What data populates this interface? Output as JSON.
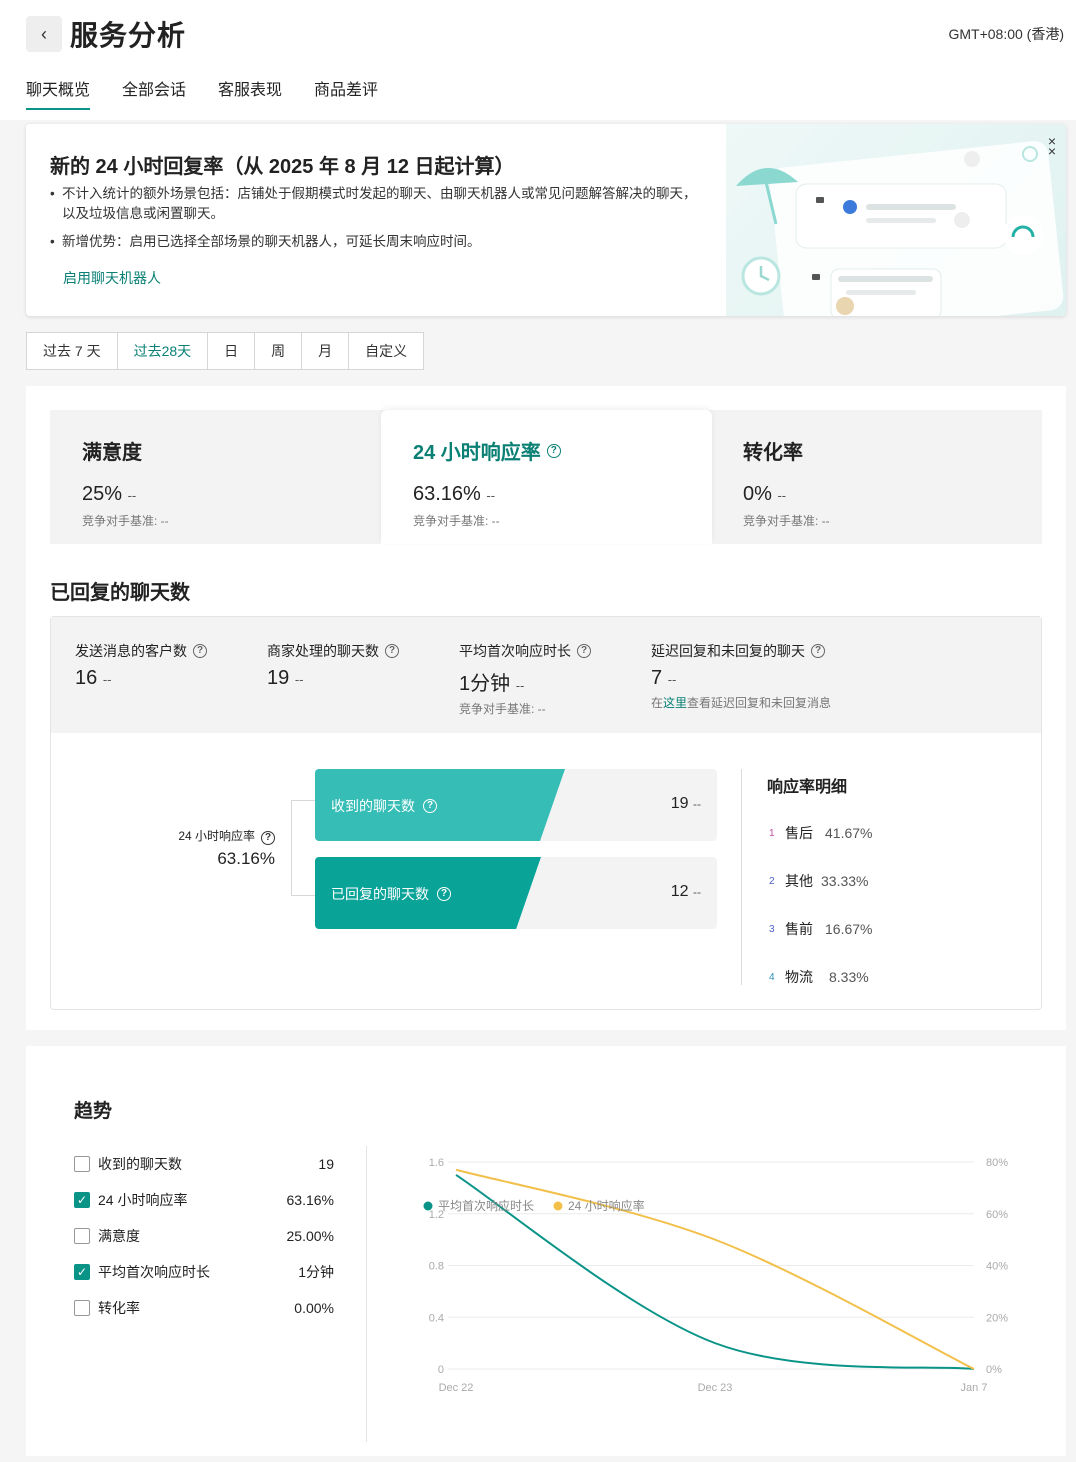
{
  "header": {
    "back_icon": "chevron-left-icon",
    "title": "服务分析",
    "timezone": "GMT+08:00 (香港)"
  },
  "tabs": [
    {
      "label": "聊天概览",
      "active": true
    },
    {
      "label": "全部会话",
      "active": false
    },
    {
      "label": "客服表现",
      "active": false
    },
    {
      "label": "商品差评",
      "active": false
    }
  ],
  "banner": {
    "title": "新的 24 小时回复率（从 2025 年 8 月 12 日起计算）",
    "bullets": [
      "不计入统计的额外场景包括：店铺处于假期模式时发起的聊天、由聊天机器人或常见问题解答解决的聊天，以及垃圾信息或闲置聊天。",
      "新增优势：启用已选择全部场景的聊天机器人，可延长周末响应时间。"
    ],
    "link": "启用聊天机器人",
    "close_icon": "close-icon"
  },
  "date_range": {
    "options": [
      "过去 7 天",
      "过去28天",
      "日",
      "周",
      "月",
      "自定义"
    ],
    "selected": "过去28天"
  },
  "kpis": [
    {
      "title": "满意度",
      "value": "25%",
      "delta": "--",
      "bench": "竞争对手基准: --",
      "active": false
    },
    {
      "title": "24 小时响应率",
      "value": "63.16%",
      "delta": "--",
      "bench": "竞争对手基准: --",
      "active": true
    },
    {
      "title": "转化率",
      "value": "0%",
      "delta": "--",
      "bench": "竞争对手基准: --",
      "active": false
    }
  ],
  "replied": {
    "section_title": "已回复的聊天数",
    "stats": [
      {
        "label": "发送消息的客户数",
        "value": "16",
        "delta": "--"
      },
      {
        "label": "商家处理的聊天数",
        "value": "19",
        "delta": "--"
      },
      {
        "label": "平均首次响应时长",
        "value": "1分钟",
        "delta": "--",
        "sub": "竞争对手基准: --"
      },
      {
        "label": "延迟回复和未回复的聊天",
        "value": "7",
        "delta": "--",
        "sub_prefix": "在",
        "sub_link": "这里",
        "sub_suffix": "查看延迟回复和未回复消息"
      }
    ],
    "rate_label": "24 小时响应率",
    "rate_value": "63.16%",
    "funnel": [
      {
        "label": "收到的聊天数",
        "value": "19",
        "delta": "--",
        "color": "#35bdb6"
      },
      {
        "label": "已回复的聊天数",
        "value": "12",
        "delta": "--",
        "color": "#0aa398"
      }
    ],
    "detail": {
      "title": "响应率明细",
      "items": [
        {
          "index": "1",
          "name": "售后",
          "pct": "41.67%",
          "index_color": "#c04ca0"
        },
        {
          "index": "2",
          "name": "其他",
          "pct": "33.33%",
          "index_color": "#4a5ec8"
        },
        {
          "index": "3",
          "name": "售前",
          "pct": "16.67%",
          "index_color": "#4a5ec8"
        },
        {
          "index": "4",
          "name": "物流",
          "pct": "8.33%",
          "index_color": "#2e8fb8"
        }
      ]
    }
  },
  "trend": {
    "title": "趋势",
    "metrics": [
      {
        "label": "收到的聊天数",
        "value": "19",
        "checked": false
      },
      {
        "label": "24 小时响应率",
        "value": "63.16%",
        "checked": true
      },
      {
        "label": "满意度",
        "value": "25.00%",
        "checked": false
      },
      {
        "label": "平均首次响应时长",
        "value": "1分钟",
        "checked": true
      },
      {
        "label": "转化率",
        "value": "0.00%",
        "checked": false
      }
    ]
  },
  "chart_data": {
    "type": "line",
    "x": [
      "Dec 22",
      "Dec 23",
      "Jan 7"
    ],
    "series": [
      {
        "name": "平均首次响应时长",
        "axis": "left",
        "color": "#0a9488",
        "values": [
          1.5,
          0.2,
          0.0
        ]
      },
      {
        "name": "24 小时响应率",
        "axis": "right",
        "color": "#f2c04a",
        "values": [
          77,
          50,
          0
        ]
      }
    ],
    "y_left": {
      "range": [
        0,
        1.6
      ],
      "ticks": [
        "0",
        "0.4",
        "0.8",
        "1.2",
        "1.6"
      ]
    },
    "y_right": {
      "range": [
        0,
        80
      ],
      "ticks": [
        "0%",
        "20%",
        "40%",
        "60%",
        "80%"
      ]
    },
    "legend_position": "top-left",
    "grid": true
  }
}
